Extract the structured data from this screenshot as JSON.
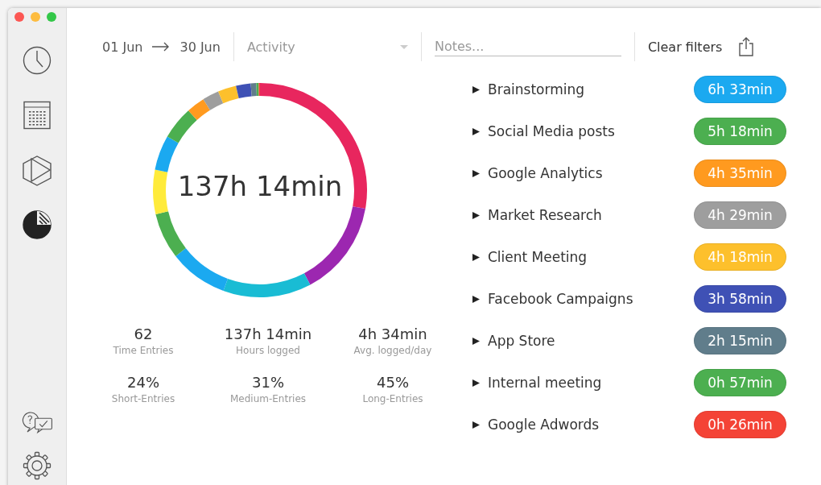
{
  "window": {
    "controls": [
      {
        "kind": "close"
      },
      {
        "kind": "minimize"
      },
      {
        "kind": "zoom"
      }
    ]
  },
  "sidebar": {
    "items": [
      {
        "kind": "clock",
        "selected": false
      },
      {
        "kind": "calendar",
        "selected": false
      },
      {
        "kind": "play",
        "selected": false
      },
      {
        "kind": "reports",
        "selected": true
      }
    ],
    "bottom_items": [
      {
        "kind": "help"
      },
      {
        "kind": "settings"
      }
    ]
  },
  "filters": {
    "date_from": "01 Jun",
    "date_to": "30 Jun",
    "activity": {
      "placeholder": "Activity"
    },
    "notes": {
      "placeholder": "Notes..."
    },
    "clear": "Clear filters"
  },
  "total": "137h 14min",
  "stats": [
    {
      "value": "62",
      "label": "Time Entries"
    },
    {
      "value": "137h 14min",
      "label": "Hours logged"
    },
    {
      "value": "4h 34min",
      "label": "Avg. logged/day"
    },
    {
      "value": "24%",
      "label": "Short-Entries"
    },
    {
      "value": "31%",
      "label": "Medium-Entries"
    },
    {
      "value": "45%",
      "label": "Long-Entries"
    }
  ],
  "activities": [
    {
      "name": "Brainstorming",
      "duration": "6h 33min",
      "color": "#1ba9f0",
      "expanded": false
    },
    {
      "name": "Social Media posts",
      "duration": "5h 18min",
      "color": "#4caf50",
      "expanded": false
    },
    {
      "name": "Google Analytics",
      "duration": "4h 35min",
      "color": "#ff9a1f",
      "expanded": false
    },
    {
      "name": "Market Research",
      "duration": "4h 29min",
      "color": "#9e9e9e",
      "expanded": false
    },
    {
      "name": "Client Meeting",
      "duration": "4h 18min",
      "color": "#fdc02c",
      "expanded": false
    },
    {
      "name": "Facebook Campaigns",
      "duration": "3h 58min",
      "color": "#3f51b5",
      "expanded": false
    },
    {
      "name": "App Store",
      "duration": "2h 15min",
      "color": "#607d8b",
      "expanded": false
    },
    {
      "name": "Internal meeting",
      "duration": "0h 57min",
      "color": "#4caf50",
      "expanded": false
    },
    {
      "name": "Google Adwords",
      "duration": "0h 26min",
      "color": "#f44336",
      "expanded": false
    }
  ]
}
